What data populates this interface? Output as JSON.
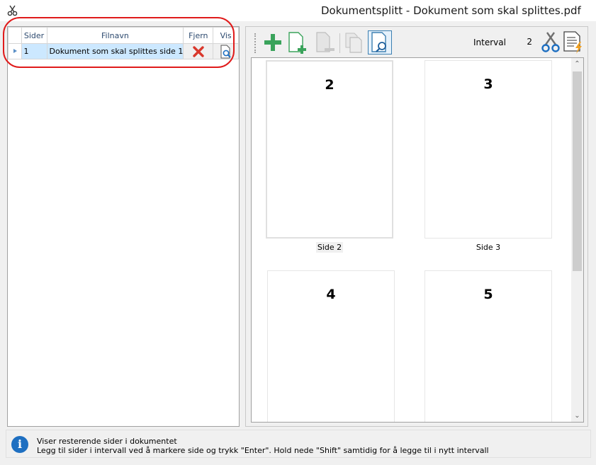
{
  "window": {
    "title": "Dokumentsplitt - Dokument som skal splittes.pdf",
    "icon": "scissors-icon"
  },
  "grid": {
    "columns": [
      "Sider",
      "Filnavn",
      "Fjern",
      "Vis"
    ],
    "rows": [
      {
        "sider": "1",
        "filnavn": "Dokument som skal splittes side 1",
        "fjern_icon": "red-x-icon",
        "vis_icon": "magnifier-page-icon"
      }
    ]
  },
  "toolbar": {
    "buttons": [
      {
        "name": "add-green-plus-icon"
      },
      {
        "name": "add-page-icon"
      },
      {
        "name": "remove-page-icon",
        "disabled": true
      },
      {
        "name": "copy-pages-icon",
        "disabled": true
      },
      {
        "name": "preview-magnifier-icon",
        "active": true
      }
    ],
    "intervall_label": "Intervall",
    "intervall_value": "2",
    "split_icon": "scissors-icon",
    "run_icon": "document-lightning-icon"
  },
  "pages": [
    {
      "number": "2",
      "caption": "Side 2",
      "selected": true
    },
    {
      "number": "3",
      "caption": "Side 3"
    },
    {
      "number": "4",
      "caption": ""
    },
    {
      "number": "5",
      "caption": ""
    }
  ],
  "status": {
    "line1": "Viser resterende sider i dokumentet",
    "line2": "Legg til sider i intervall ved å markere side og trykk \"Enter\". Hold nede \"Shift\" samtidig for å legge til i nytt intervall"
  },
  "colors": {
    "selection": "#cce8ff",
    "highlight": "#e01b1b",
    "accent_green": "#3aa35b",
    "info_blue": "#1e6fc1"
  }
}
